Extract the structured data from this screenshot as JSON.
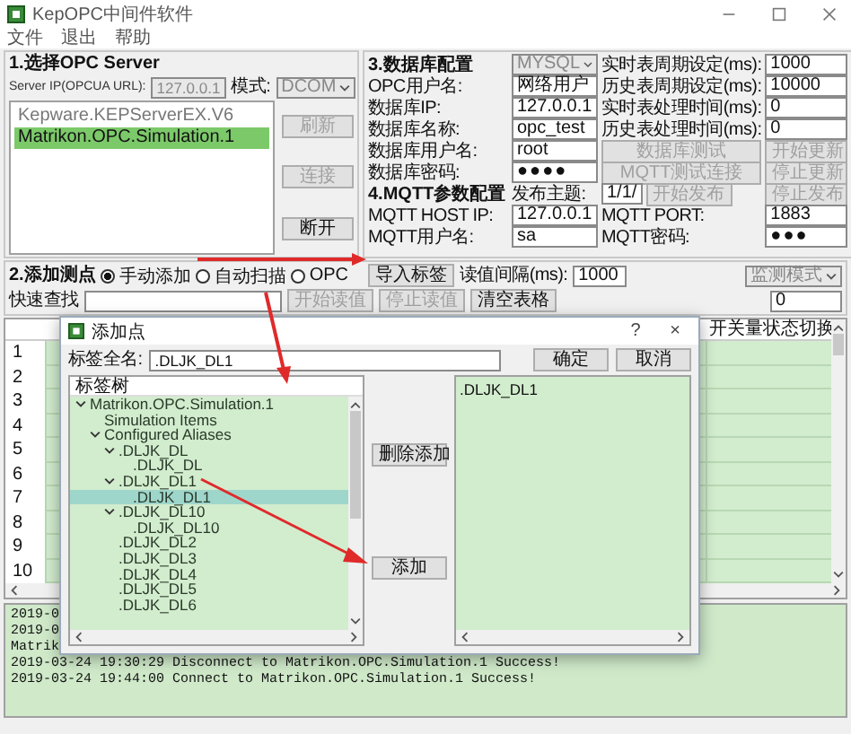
{
  "window": {
    "title": "KepOPC中间件软件"
  },
  "menu": [
    "文件",
    "退出",
    "帮助"
  ],
  "opc_server": {
    "heading": "1.选择OPC Server",
    "ip_label": "Server IP(OPCUA URL):",
    "ip_value": "127.0.0.1",
    "mode_label": "模式:",
    "mode_value": "DCOM",
    "servers": [
      {
        "name": "Kepware.KEPServerEX.V6",
        "selected": false
      },
      {
        "name": "Matrikon.OPC.Simulation.1",
        "selected": true
      }
    ],
    "buttons": [
      {
        "label": "刷新",
        "disabled": true
      },
      {
        "label": "连接",
        "disabled": true
      },
      {
        "label": "断开",
        "disabled": false
      }
    ]
  },
  "config_rows": [
    [
      {
        "kind": "heading",
        "text": "3.数据库配置"
      },
      {
        "kind": "select",
        "text": "MYSQL"
      },
      {
        "kind": "label",
        "text": "实时表周期设定(ms):"
      },
      {
        "kind": "input",
        "text": "1000"
      }
    ],
    [
      {
        "kind": "label",
        "text": "OPC用户名:"
      },
      {
        "kind": "input",
        "text": "网络用户"
      },
      {
        "kind": "label",
        "text": "历史表周期设定(ms):"
      },
      {
        "kind": "input",
        "text": "10000"
      }
    ],
    [
      {
        "kind": "label",
        "text": "数据库IP:"
      },
      {
        "kind": "input",
        "text": "127.0.0.1"
      },
      {
        "kind": "label",
        "text": "实时表处理时间(ms):"
      },
      {
        "kind": "input",
        "text": "0"
      }
    ],
    [
      {
        "kind": "label",
        "text": "数据库名称:"
      },
      {
        "kind": "input",
        "text": "opc_test"
      },
      {
        "kind": "label",
        "text": "历史表处理时间(ms):"
      },
      {
        "kind": "input",
        "text": "0"
      }
    ],
    [
      {
        "kind": "label",
        "text": "数据库用户名:"
      },
      {
        "kind": "input",
        "text": "root"
      },
      {
        "kind": "button",
        "text": "数据库测试",
        "disabled": true
      },
      {
        "kind": "button",
        "text": "开始更新",
        "disabled": true
      }
    ],
    [
      {
        "kind": "label",
        "text": "数据库密码:"
      },
      {
        "kind": "password",
        "text": "●●●●"
      },
      {
        "kind": "button",
        "text": "MQTT测试连接",
        "disabled": true
      },
      {
        "kind": "button",
        "text": "停止更新",
        "disabled": true
      }
    ],
    [
      {
        "kind": "heading",
        "text": "4.MQTT参数配置"
      },
      {
        "kind": "label",
        "text": "发布主题:"
      },
      {
        "kind": "group",
        "items": [
          {
            "kind": "input",
            "text": "1/1/"
          },
          {
            "kind": "button",
            "text": "开始发布",
            "disabled": true
          }
        ]
      },
      {
        "kind": "button",
        "text": "停止发布",
        "disabled": true
      }
    ],
    [
      {
        "kind": "label",
        "text": "MQTT HOST IP:"
      },
      {
        "kind": "input",
        "text": "127.0.0.1"
      },
      {
        "kind": "label",
        "text": "MQTT PORT:"
      },
      {
        "kind": "input",
        "text": "1883"
      }
    ],
    [
      {
        "kind": "label",
        "text": "MQTT用户名:"
      },
      {
        "kind": "input",
        "text": "sa"
      },
      {
        "kind": "label",
        "text": "MQTT密码:"
      },
      {
        "kind": "password",
        "text": "●●●"
      }
    ]
  ],
  "acquisition": {
    "heading": "2.添加测点",
    "modes": [
      {
        "label": "手动添加",
        "selected": true
      },
      {
        "label": "自动扫描",
        "selected": false
      },
      {
        "label": "OPC",
        "selected": false
      }
    ],
    "import_button": "导入标签",
    "interval_label": "读值间隔(ms):",
    "interval": "1000",
    "monitor_mode": "监测模式",
    "buttons": [
      {
        "label": "开始读值",
        "disabled": true
      },
      {
        "label": "停止读值",
        "disabled": true
      },
      {
        "label": "清空表格",
        "disabled": false
      }
    ],
    "search_label": "快速查找",
    "count": "0"
  },
  "table": {
    "last_column": "开关量状态切换",
    "rows": [
      "1",
      "2",
      "3",
      "4",
      "5",
      "6",
      "7",
      "8",
      "9",
      "10"
    ]
  },
  "log": [
    "2019-0",
    "2019-0",
    "Matrik",
    "2019-03-24 19:30:29  Disconnect to Matrikon.OPC.Simulation.1 Success!",
    "2019-03-24 19:44:00  Connect to Matrikon.OPC.Simulation.1 Success!"
  ],
  "dialog": {
    "title": "添加点",
    "help": "?",
    "close": "×",
    "tag_label": "标签全名:",
    "tag_value": ".DLJK_DL1",
    "ok": "确定",
    "cancel": "取消",
    "tree_header": "标签树",
    "tree": [
      {
        "label": "Matrikon.OPC.Simulation.1",
        "expanded": true,
        "selected": false,
        "children": [
          {
            "label": "Simulation Items",
            "selected": false
          },
          {
            "label": "Configured Aliases",
            "expanded": true,
            "selected": false,
            "children": [
              {
                "label": ".DLJK_DL",
                "expanded": true,
                "selected": false,
                "children": [
                  {
                    "label": ".DLJK_DL",
                    "selected": false
                  }
                ]
              },
              {
                "label": ".DLJK_DL1",
                "expanded": true,
                "selected": false,
                "children": [
                  {
                    "label": ".DLJK_DL1",
                    "selected": true
                  }
                ]
              },
              {
                "label": ".DLJK_DL10",
                "expanded": true,
                "selected": false,
                "children": [
                  {
                    "label": ".DLJK_DL10",
                    "selected": false
                  }
                ]
              },
              {
                "label": ".DLJK_DL2",
                "selected": false
              },
              {
                "label": ".DLJK_DL3",
                "selected": false
              },
              {
                "label": ".DLJK_DL4",
                "selected": false
              },
              {
                "label": ".DLJK_DL5",
                "selected": false
              },
              {
                "label": ".DLJK_DL6",
                "selected": false
              }
            ]
          }
        ]
      }
    ],
    "remove_button": "删除添加",
    "add_button": "添加",
    "added": [
      ".DLJK_DL1"
    ]
  }
}
